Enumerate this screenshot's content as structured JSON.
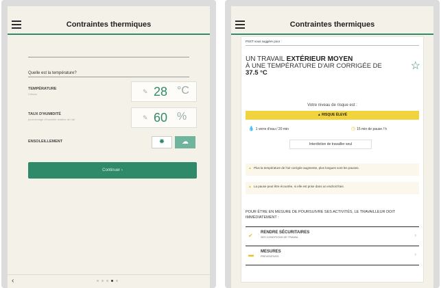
{
  "left_screen": {
    "header": {
      "title": "Contraintes thermiques"
    },
    "question": "Quelle est la température?",
    "temperature": {
      "label": "TEMPÉRATURE",
      "sublabel": "Celsius",
      "value": "28",
      "unit": "°C"
    },
    "humidity": {
      "label": "TAUX D'HUMIDITÉ",
      "sublabel": "pourcentage d'humidité relative de l'air",
      "value": "60",
      "unit": "%"
    },
    "ensoleillement": {
      "label": "ENSOLEILLEMENT",
      "sun_icon": "sun-icon",
      "cloud_icon": "cloud-icon"
    },
    "calc_button": "Continuer ›",
    "footer": {
      "back": "‹",
      "pages": 5,
      "current_page": 4
    }
  },
  "right_screen": {
    "header": {
      "title": "Contraintes thermiques"
    },
    "suggestion_label": "PSST vous suggère pour :",
    "headline_line1_prefix": "UN TRAVAIL ",
    "headline_line1_bold": "EXTÉRIEUR MOYEN",
    "headline_line2": "À UNE TEMPÉRATURE D'AIR CORRIGÉE DE",
    "headline_value": "37.5 °C",
    "risk_title": "Votre niveau de risque est :",
    "risk_level": "▲ RISQUE ÉLEVÉ",
    "risk_color": "#f1d33d",
    "water_text": "1 verre d'eau / 20 min",
    "pause_text": "15 min de pause / h",
    "interdiction": "Interdiction de travailler seul",
    "warnings": [
      "Plus la température de l'air corrigée augmente, plus longues sont les pauses.",
      "La pause peut être écourtée, si elle est prise dans un endroit frais."
    ],
    "pour_text": "POUR ÊTRE EN MESURE DE POURSUIVRE SES ACTIVITÉS, LE TRAVAILLEUR DOIT IMMÉDIATEMENT :",
    "links": [
      {
        "title": "RENDRE SÉCURITAIRES",
        "subtitle": "SES CONDITIONS DE TRAVAIL",
        "icon": "check-icon"
      },
      {
        "title": "MESURES",
        "subtitle": "PRÉVENTIVES",
        "icon": "measures-icon"
      }
    ]
  },
  "colors": {
    "accent": "#2f8a6a",
    "background": "#f4f1e8",
    "warning": "#f1d33d"
  }
}
